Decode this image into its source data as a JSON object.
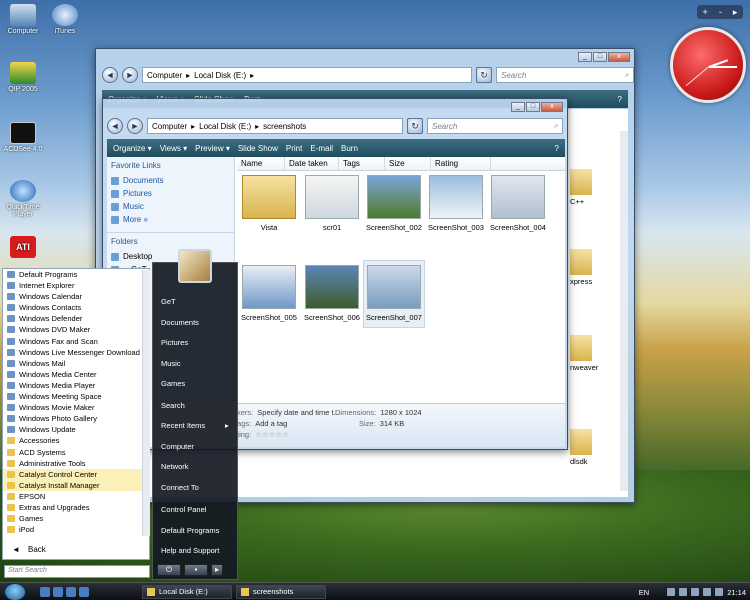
{
  "desktop": {
    "icons": [
      {
        "label": "Computer"
      },
      {
        "label": "iTunes"
      },
      {
        "label": "QIP 2005"
      },
      {
        "label": "ACDSee 4.0"
      },
      {
        "label": "QuickTime Player"
      },
      {
        "label": "ATI"
      }
    ]
  },
  "gadget": {
    "plus": "+",
    "minus": "-",
    "next": "▸"
  },
  "back_window": {
    "address": {
      "parts": [
        "Computer",
        "Local Disk (E:)"
      ]
    },
    "search_placeholder": "Search",
    "commands": [
      "Organize ▾",
      "Views ▾",
      "Slide Show",
      "Burn"
    ],
    "right_items": [
      "C++",
      "xpress",
      "nweaver",
      "dlsdk"
    ]
  },
  "front_window": {
    "address": {
      "parts": [
        "Computer",
        "Local Disk (E:)",
        "screenshots"
      ]
    },
    "search_placeholder": "Search",
    "commands": [
      "Organize ▾",
      "Views ▾",
      "Preview ▾",
      "Slide Show",
      "Print",
      "E-mail",
      "Burn"
    ],
    "nav": {
      "favorite_links_label": "Favorite Links",
      "links": [
        "Documents",
        "Pictures",
        "Music"
      ],
      "more_label": "More »",
      "folders_label": "Folders",
      "tree": [
        "Desktop",
        "GeT"
      ]
    },
    "columns": [
      "Name",
      "Date taken",
      "Tags",
      "Size",
      "Rating"
    ],
    "items": [
      {
        "name": "Vista"
      },
      {
        "name": "scr01"
      },
      {
        "name": "ScreenShot_002"
      },
      {
        "name": "ScreenShot_003"
      },
      {
        "name": "ScreenShot_004"
      },
      {
        "name": "ScreenShot_005"
      },
      {
        "name": "ScreenShot_006"
      },
      {
        "name": "ScreenShot_007"
      }
    ],
    "details": {
      "takers_label": "kers:",
      "takers_value": "Specify date and time t...",
      "dimensions_label": "Dimensions:",
      "dimensions_value": "1280 x 1024",
      "tags_label": "ags:",
      "tags_value": "Add a tag",
      "size_label": "Size:",
      "size_value": "314 KB",
      "rating_label": "ting:",
      "rating_stars": "☆☆☆☆☆"
    }
  },
  "start_menu": {
    "programs": [
      "Default Programs",
      "Internet Explorer",
      "Windows Calendar",
      "Windows Contacts",
      "Windows Defender",
      "Windows DVD Maker",
      "Windows Fax and Scan",
      "Windows Live Messenger Download",
      "Windows Mail",
      "Windows Media Center",
      "Windows Media Player",
      "Windows Meeting Space",
      "Windows Movie Maker",
      "Windows Photo Gallery",
      "Windows Update",
      "Accessories",
      "ACD Systems",
      "Administrative Tools",
      "Catalyst Control Center",
      "Catalyst Install Manager",
      "EPSON",
      "Extras and Upgrades",
      "Games",
      "iPod"
    ],
    "back_label": "Back",
    "search_placeholder": "Start Search",
    "right_items": [
      "GeT",
      "Documents",
      "Pictures",
      "Music",
      "Games",
      "Search",
      "Recent Items",
      "Computer",
      "Network",
      "Connect To",
      "Control Panel",
      "Default Programs",
      "Help and Support"
    ]
  },
  "taskbar": {
    "buttons": [
      "Local Disk (E:)",
      "screenshots"
    ],
    "language": "EN",
    "time": "21:14"
  }
}
